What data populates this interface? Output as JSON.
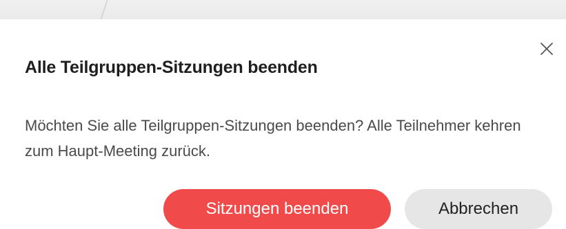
{
  "dialog": {
    "title": "Alle Teilgruppen-Sitzungen beenden",
    "message": "Möchten Sie alle Teilgruppen-Sitzungen beenden? Alle Teilnehmer kehren zum Haupt-Meeting zurück.",
    "confirm_label": "Sitzungen beenden",
    "cancel_label": "Abbrechen",
    "close_icon": "close-icon"
  },
  "colors": {
    "confirm_bg": "#f04a4a",
    "cancel_bg": "#e6e6e6",
    "title_text": "#1f1f1f",
    "message_text": "#4a4a4a"
  }
}
